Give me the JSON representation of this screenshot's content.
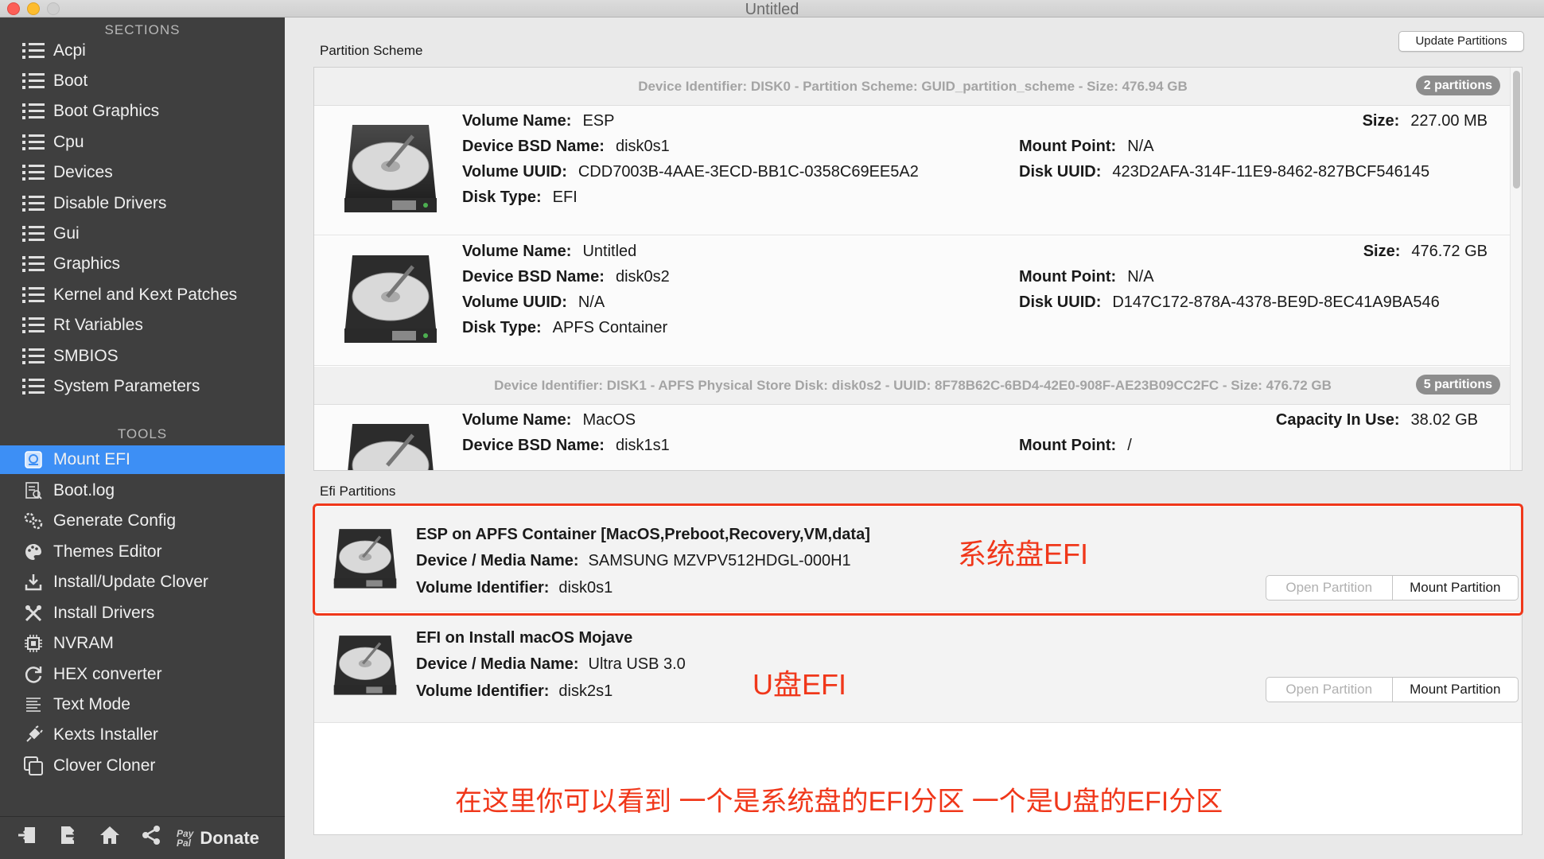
{
  "window": {
    "title": "Untitled"
  },
  "sidebar": {
    "sections_header": "SECTIONS",
    "sections": [
      {
        "label": "Acpi"
      },
      {
        "label": "Boot"
      },
      {
        "label": "Boot Graphics"
      },
      {
        "label": "Cpu"
      },
      {
        "label": "Devices"
      },
      {
        "label": "Disable Drivers"
      },
      {
        "label": "Gui"
      },
      {
        "label": "Graphics"
      },
      {
        "label": "Kernel and Kext Patches"
      },
      {
        "label": "Rt Variables"
      },
      {
        "label": "SMBIOS"
      },
      {
        "label": "System Parameters"
      }
    ],
    "tools_header": "TOOLS",
    "tools": [
      {
        "label": "Mount EFI",
        "icon": "mount-efi-icon",
        "selected": true
      },
      {
        "label": "Boot.log",
        "icon": "log-icon"
      },
      {
        "label": "Generate Config",
        "icon": "gears-icon"
      },
      {
        "label": "Themes Editor",
        "icon": "palette-icon"
      },
      {
        "label": "Install/Update Clover",
        "icon": "download-icon"
      },
      {
        "label": "Install Drivers",
        "icon": "tools-icon"
      },
      {
        "label": "NVRAM",
        "icon": "chip-icon"
      },
      {
        "label": "HEX converter",
        "icon": "refresh-icon"
      },
      {
        "label": "Text Mode",
        "icon": "text-icon"
      },
      {
        "label": "Kexts Installer",
        "icon": "plug-icon"
      },
      {
        "label": "Clover Cloner",
        "icon": "clone-icon"
      }
    ],
    "bottom": {
      "paypal_text": "Pay\nPal",
      "donate_label": "Donate"
    }
  },
  "partition_scheme": {
    "group_label": "Partition Scheme",
    "update_button": "Update Partitions",
    "devices": [
      {
        "header": "Device Identifier: DISK0 - Partition Scheme: GUID_partition_scheme - Size: 476.94 GB",
        "badge": "2 partitions"
      },
      {
        "header": "Device Identifier: DISK1 - APFS Physical Store Disk: disk0s2 - UUID: 8F78B62C-6BD4-42E0-908F-AE23B09CC2FC - Size: 476.72 GB",
        "badge": "5 partitions"
      }
    ],
    "volumes": [
      {
        "volume_name_key": "Volume Name:",
        "volume_name": "ESP",
        "bsd_key": "Device BSD Name:",
        "bsd": "disk0s1",
        "uuid_key": "Volume UUID:",
        "uuid": "CDD7003B-4AAE-3ECD-BB1C-0358C69EE5A2",
        "type_key": "Disk Type:",
        "type": "EFI",
        "size_key": "Size:",
        "size": "227.00 MB",
        "mount_key": "Mount Point:",
        "mount": "N/A",
        "disk_uuid_key": "Disk UUID:",
        "disk_uuid": "423D2AFA-314F-11E9-8462-827BCF546145"
      },
      {
        "volume_name_key": "Volume Name:",
        "volume_name": "Untitled",
        "bsd_key": "Device BSD Name:",
        "bsd": "disk0s2",
        "uuid_key": "Volume UUID:",
        "uuid": "N/A",
        "type_key": "Disk Type:",
        "type": "APFS Container",
        "size_key": "Size:",
        "size": "476.72 GB",
        "mount_key": "Mount Point:",
        "mount": "N/A",
        "disk_uuid_key": "Disk UUID:",
        "disk_uuid": "D147C172-878A-4378-BE9D-8EC41A9BA546"
      },
      {
        "volume_name_key": "Volume Name:",
        "volume_name": "MacOS",
        "bsd_key": "Device BSD Name:",
        "bsd": "disk1s1",
        "size_key": "Capacity In Use:",
        "size": "38.02 GB",
        "mount_key": "Mount Point:",
        "mount": "/"
      }
    ]
  },
  "efi_partitions": {
    "group_label": "Efi Partitions",
    "items": [
      {
        "title": "ESP on APFS Container [MacOS,Preboot,Recovery,VM,data]",
        "media_key": "Device / Media Name:",
        "media": "SAMSUNG MZVPV512HDGL-000H1",
        "vid_key": "Volume Identifier:",
        "vid": "disk0s1",
        "open_button": "Open Partition",
        "mount_button": "Mount Partition"
      },
      {
        "title": "EFI on Install macOS Mojave",
        "media_key": "Device / Media Name:",
        "media": "Ultra USB 3.0",
        "vid_key": "Volume Identifier:",
        "vid": "disk2s1",
        "open_button": "Open Partition",
        "mount_button": "Mount Partition"
      }
    ]
  },
  "annotations": {
    "system_efi": "系统盘EFI",
    "usb_efi": "U盘EFI",
    "bottom_note": "在这里你可以看到 一个是系统盘的EFI分区 一个是U盘的EFI分区",
    "color": "#f0371a"
  },
  "colors": {
    "sidebar_bg": "#3f3f3f",
    "selected": "#3d8ff5"
  }
}
